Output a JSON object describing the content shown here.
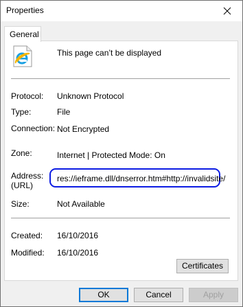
{
  "window": {
    "title": "Properties"
  },
  "tabs": [
    {
      "label": "General"
    }
  ],
  "page": {
    "title": "This page can’t be displayed",
    "icon": "internet-explorer-icon"
  },
  "fields": {
    "protocol": {
      "label": "Protocol:",
      "value": "Unknown Protocol"
    },
    "type": {
      "label": "Type:",
      "value": "File"
    },
    "connection": {
      "label": "Connection:",
      "value": "Not Encrypted"
    },
    "zone": {
      "label": "Zone:",
      "value": "Internet | Protected Mode: On"
    },
    "address": {
      "label": "Address:",
      "sublabel": "(URL)",
      "value": "res://ieframe.dll/dnserror.htm#http://invalidsite/"
    },
    "size": {
      "label": "Size:",
      "value": "Not Available"
    },
    "created": {
      "label": "Created:",
      "value": "16/10/2016"
    },
    "modified": {
      "label": "Modified:",
      "value": "16/10/2016"
    }
  },
  "buttons": {
    "certificates": "Certificates",
    "ok": "OK",
    "cancel": "Cancel",
    "apply": "Apply"
  },
  "colors": {
    "highlight": "#0b1be3",
    "ie_blue": "#1ba1e2",
    "ie_gold": "#f5b400"
  }
}
